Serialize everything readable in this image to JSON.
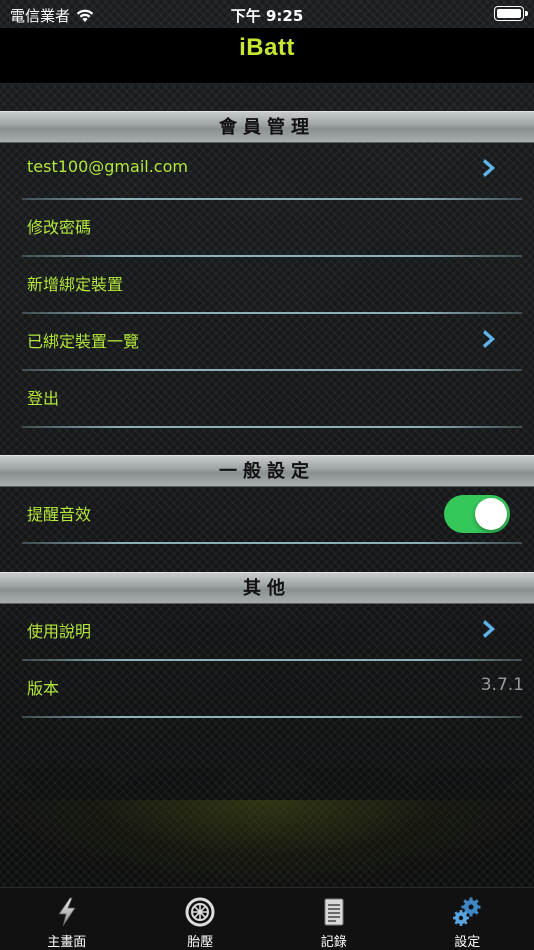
{
  "status": {
    "carrier": "電信業者",
    "time": "下午 9:25"
  },
  "nav": {
    "title": "iBatt"
  },
  "sections": {
    "member": {
      "title": "會員管理"
    },
    "general": {
      "title": "一般設定"
    },
    "other": {
      "title": "其他"
    }
  },
  "member_rows": {
    "email": "test100@gmail.com",
    "change_password": "修改密碼",
    "add_device": "新增綁定裝置",
    "bound_devices": "已綁定裝置一覽",
    "logout": "登出"
  },
  "general_rows": {
    "sound": "提醒音效",
    "sound_enabled": true
  },
  "other_rows": {
    "help": "使用說明",
    "version_label": "版本",
    "version_value": "3.7.1"
  },
  "tabs": [
    {
      "label": "主畫面",
      "icon": "lightning-icon"
    },
    {
      "label": "胎壓",
      "icon": "tire-icon"
    },
    {
      "label": "記錄",
      "icon": "document-icon"
    },
    {
      "label": "設定",
      "icon": "gears-icon",
      "active": true
    }
  ],
  "colors": {
    "accent": "#b4e83a",
    "title": "#c6e832",
    "toggle_on": "#35c759",
    "chevron": "#5fb3e8"
  }
}
